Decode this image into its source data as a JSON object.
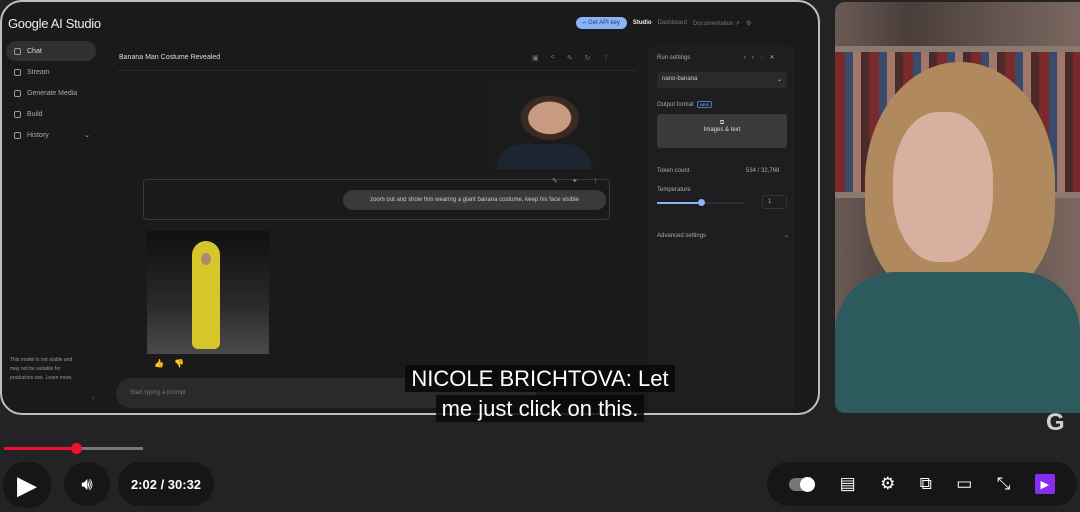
{
  "app": {
    "logo": "Google AI Studio",
    "title": "Banana Man Costume Revealed"
  },
  "sidebar": {
    "items": [
      {
        "label": "Chat"
      },
      {
        "label": "Stream"
      },
      {
        "label": "Generate Media"
      },
      {
        "label": "Build"
      },
      {
        "label": "History"
      }
    ],
    "disclaimer": "This model is not stable and may not be suitable for production use. Learn more."
  },
  "topnav": {
    "api_key": "⌐ Get API key",
    "studio": "Studio",
    "dashboard": "Dashboard",
    "documentation": "Documentation ↗"
  },
  "chat": {
    "user_prompt": "zoom out and show him wearing a giant banana costume, keep his face visible",
    "input_placeholder": "Start typing a prompt"
  },
  "run_settings": {
    "title": "Run settings",
    "model": "nano-banana",
    "output_format_label": "Output format",
    "new_badge": "NEW",
    "output_format": "Images & text",
    "token_count_label": "Token count",
    "token_count": "534 / 32,768",
    "temperature_label": "Temperature",
    "temperature": "1",
    "temperature_fraction": 0.5,
    "advanced": "Advanced settings"
  },
  "caption": {
    "line1": "NICOLE BRICHTOVA: Let",
    "line2": "me just click on this."
  },
  "player": {
    "current": "2:02",
    "duration": "30:32",
    "time_display": "2:02 / 30:32",
    "progress_fraction": 0.067,
    "accent": "#f0102f"
  }
}
